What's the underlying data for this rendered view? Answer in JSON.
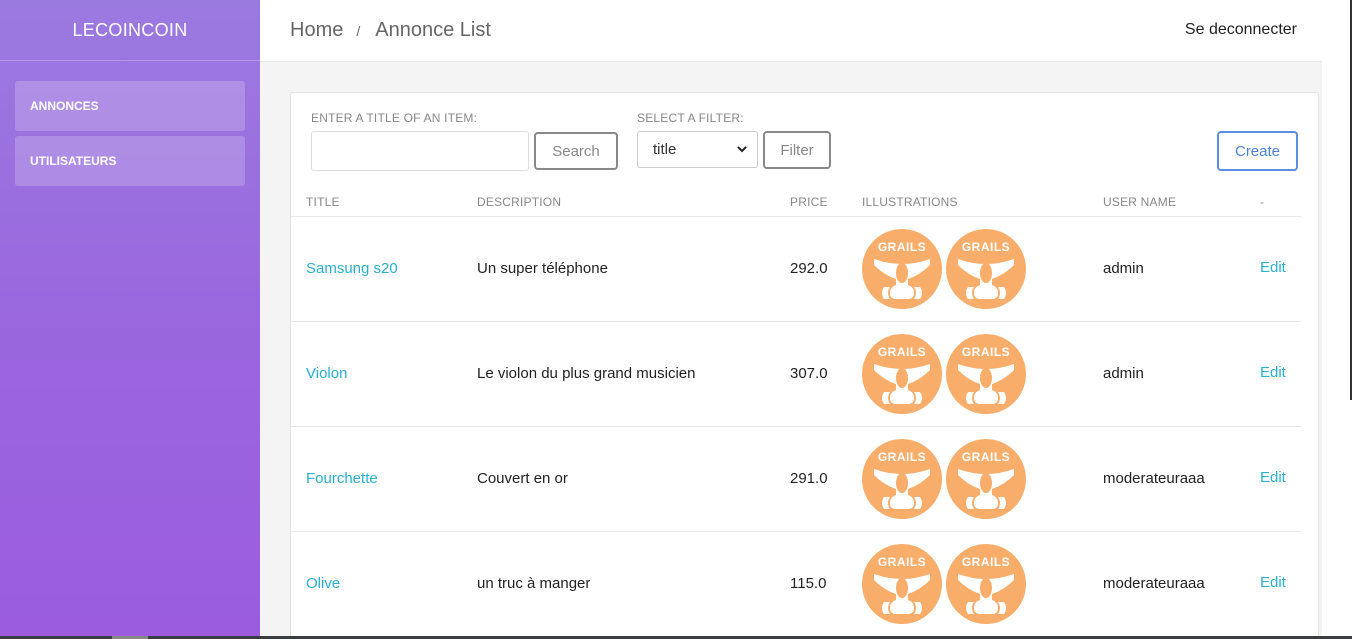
{
  "sidebar": {
    "brand": "LECOINCOIN",
    "items": [
      {
        "label": "ANNONCES"
      },
      {
        "label": "UTILISATEURS"
      }
    ]
  },
  "header": {
    "breadcrumb": {
      "home": "Home",
      "separator": "/",
      "current": "Annonce List"
    },
    "logout": "Se deconnecter"
  },
  "filters": {
    "search_label": "ENTER A TITLE OF AN ITEM:",
    "search_value": "",
    "search_button": "Search",
    "filter_label": "SELECT A FILTER:",
    "filter_selected": "title",
    "filter_button": "Filter",
    "create_button": "Create"
  },
  "table": {
    "columns": [
      "TITLE",
      "DESCRIPTION",
      "PRICE",
      "ILLUSTRATIONS",
      "USER NAME",
      "-"
    ],
    "rows": [
      {
        "title": "Samsung s20",
        "description": "Un super téléphone",
        "price": "292.0",
        "illustrations": [
          "grails-logo",
          "grails-logo"
        ],
        "user": "admin",
        "action": "Edit"
      },
      {
        "title": "Violon",
        "description": "Le violon du plus grand musicien",
        "price": "307.0",
        "illustrations": [
          "grails-logo",
          "grails-logo"
        ],
        "user": "admin",
        "action": "Edit"
      },
      {
        "title": "Fourchette",
        "description": "Couvert en or",
        "price": "291.0",
        "illustrations": [
          "grails-logo",
          "grails-logo"
        ],
        "user": "moderateuraaa",
        "action": "Edit"
      },
      {
        "title": "Olive",
        "description": "un truc à manger",
        "price": "115.0",
        "illustrations": [
          "grails-logo",
          "grails-logo"
        ],
        "user": "moderateuraaa",
        "action": "Edit"
      }
    ],
    "logo_text": "GRAILS"
  },
  "colors": {
    "sidebar_top": "#9b7ae0",
    "sidebar_bottom": "#9b5ce0",
    "link": "#2ab0d0",
    "create": "#4d82d8",
    "logo": "#f8ad6b"
  }
}
